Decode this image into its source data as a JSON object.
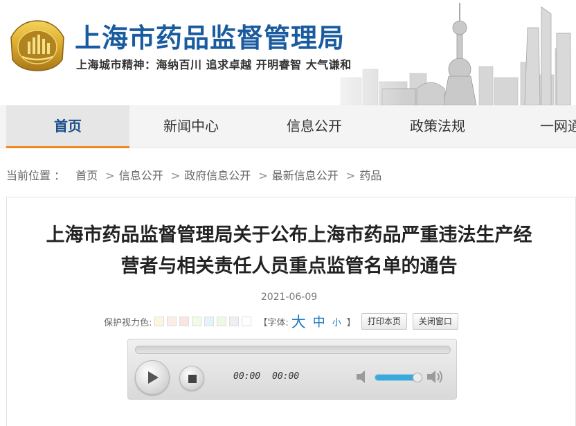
{
  "header": {
    "site_title": "上海市药品监督管理局",
    "slogan": "上海城市精神：海纳百川  追求卓越  开明睿智  大气谦和",
    "logo_icon": "sh-drug-admin-emblem",
    "skyline_icon": "shanghai-skyline-image"
  },
  "nav": {
    "items": [
      {
        "label": "首页",
        "active": true
      },
      {
        "label": "新闻中心"
      },
      {
        "label": "信息公开"
      },
      {
        "label": "政策法规"
      },
      {
        "label": "一网通"
      }
    ]
  },
  "breadcrumb": {
    "prefix": "当前位置 ：",
    "items": [
      "首页",
      "信息公开",
      "政府信息公开",
      "最新信息公开",
      "药品"
    ],
    "separator": ">"
  },
  "article": {
    "title_line1": "上海市药品监督管理局关于公布上海市药品严重违法生产经",
    "title_line2": "营者与相关责任人员重点监管名单的通告",
    "date": "2021-06-09"
  },
  "tools": {
    "eye_color_label": "保护视力色:",
    "swatch_colors": [
      "#fcf6e1",
      "#fbeee4",
      "#fce4e2",
      "#f1fbe5",
      "#e2f5fb",
      "#eef9e2",
      "#efefef",
      "#ffffff"
    ],
    "font_label": "【字体:",
    "font_big": "大",
    "font_mid": "中",
    "font_small": "小",
    "bracket_end": "】",
    "print_button": "打印本页",
    "close_button": "关闭窗口"
  },
  "player": {
    "current_time": "00:00",
    "duration": "00:00",
    "volume_level": 1.0
  },
  "colors": {
    "brand_blue": "#1a5ba0",
    "nav_active_underline": "#f08a1c",
    "font_link_blue": "#1a78c2"
  }
}
